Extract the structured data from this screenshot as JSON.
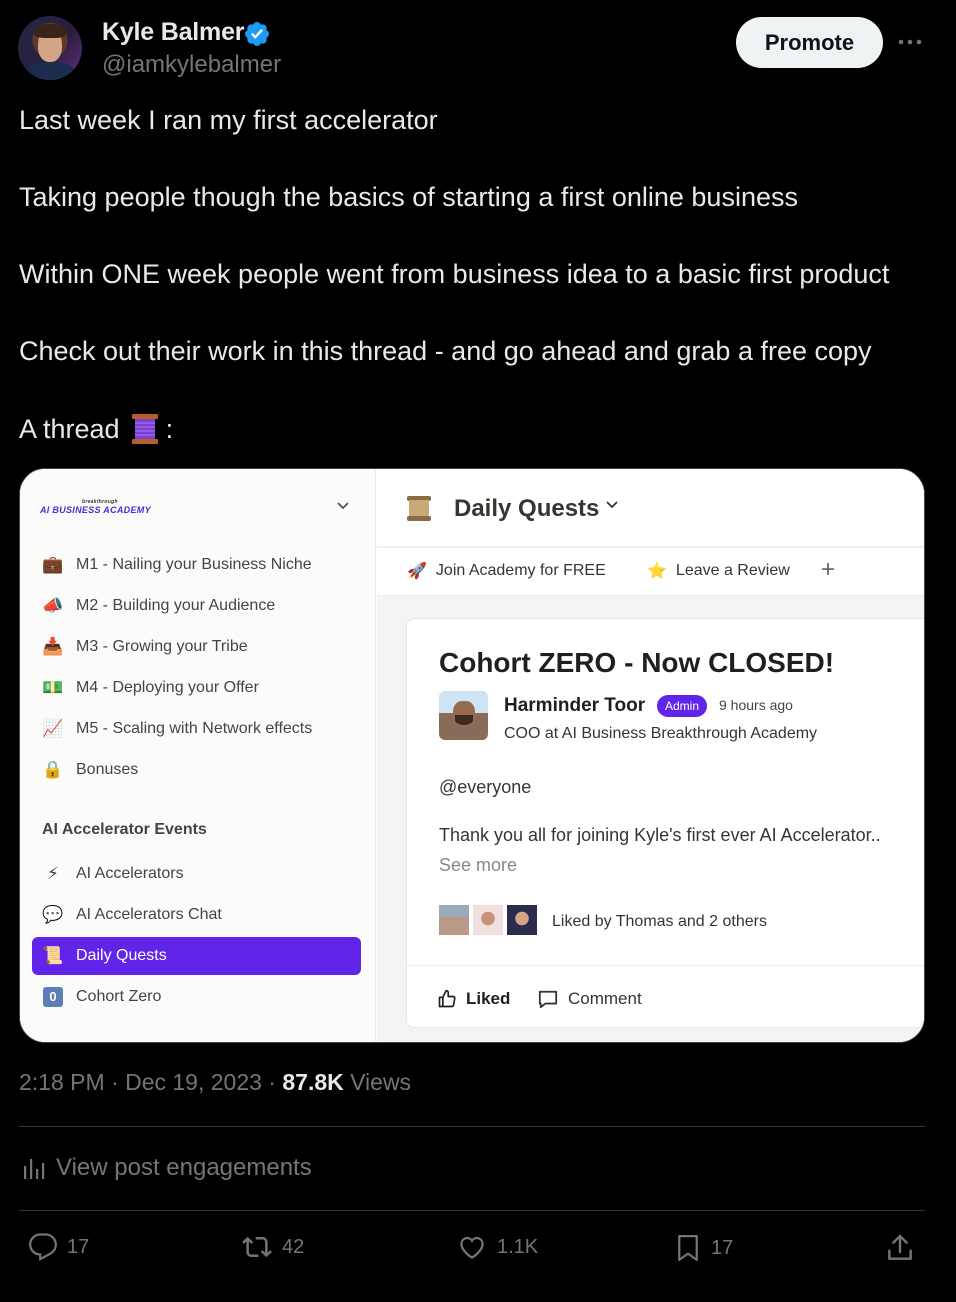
{
  "author": {
    "name": "Kyle Balmer",
    "handle": "@iamkylebalmer",
    "verified": true
  },
  "header": {
    "promote_label": "Promote",
    "more_icon": "more-horizontal-icon"
  },
  "tweet": {
    "lines": [
      "Last week I ran my first accelerator",
      "Taking people though the basics of starting a first online business",
      "Within ONE week people went from business idea to a basic first product",
      "Check out their work in this thread - and go ahead and grab a free copy",
      "A thread",
      ":"
    ],
    "thread_emoji": "🧵"
  },
  "card": {
    "logo_text": "AI BUSINESS ACADEMY",
    "logo_sub": "breakthrough",
    "sidebar_items": [
      {
        "icon": "💼",
        "label": "M1 - Nailing your Business Niche"
      },
      {
        "icon": "📣",
        "label": "M2 - Building your Audience"
      },
      {
        "icon": "📥",
        "label": "M3 - Growing your Tribe"
      },
      {
        "icon": "💵",
        "label": "M4 - Deploying your Offer"
      },
      {
        "icon": "📈",
        "label": "M5 - Scaling with Network effects"
      },
      {
        "icon": "🔒",
        "label": "Bonuses"
      }
    ],
    "section_title": "AI Accelerator Events",
    "event_items": [
      {
        "icon": "⚡",
        "label": "AI Accelerators"
      },
      {
        "icon": "💬",
        "label": "AI Accelerators Chat"
      },
      {
        "icon": "📜",
        "label": "Daily Quests",
        "active": true
      },
      {
        "icon": "0",
        "label": "Cohort Zero"
      }
    ],
    "channel_title": "Daily Quests",
    "links": [
      {
        "icon": "🚀",
        "label": "Join Academy for FREE"
      },
      {
        "icon": "⭐",
        "label": "Leave a Review"
      }
    ],
    "add_icon": "+",
    "post": {
      "title": "Cohort ZERO - Now CLOSED!",
      "author": "Harminder Toor",
      "badge": "Admin",
      "time": "9 hours ago",
      "role": "COO at AI Business Breakthrough Academy",
      "mention": "@everyone",
      "body": "Thank you all for joining Kyle's first ever AI Accelerator..",
      "see_more": "See more",
      "liked_by": "Liked by Thomas and 2 others",
      "liked_label": "Liked",
      "comment_label": "Comment"
    },
    "accent": "#6025e8"
  },
  "meta": {
    "time": "2:18 PM · Dec 19, 2023 · ",
    "views_count": "87.8K",
    "views_label": " Views"
  },
  "engagements_label": "View post engagements",
  "stats": {
    "replies": "17",
    "reposts": "42",
    "likes": "1.1K",
    "bookmarks": "17"
  }
}
